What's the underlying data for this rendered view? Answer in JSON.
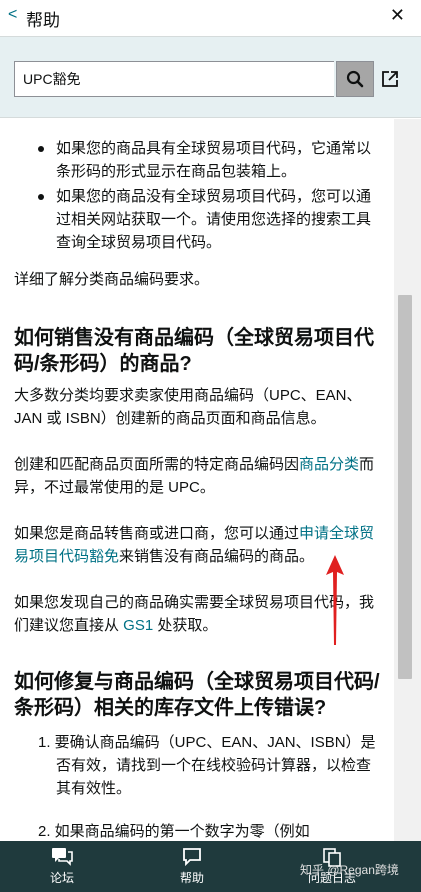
{
  "header": {
    "back_label": "<",
    "title": "帮助",
    "close_label": "✕"
  },
  "search": {
    "value": "UPC豁免",
    "placeholder": ""
  },
  "content": {
    "bullets": [
      "如果您的商品具有全球贸易项目代码，它通常以条形码的形式显示在商品包装箱上。",
      "如果您的商品没有全球贸易项目代码，您可以通过相关网站获取一个。请使用您选择的搜索工具查询全球贸易项目代码。"
    ],
    "learn_more_link": "详细了解分类商品编码要求。",
    "section1": {
      "heading": "如何销售没有商品编码（全球贸易项目代码/条形码）的商品?",
      "p1": "大多数分类均要求卖家使用商品编码（UPC、EAN、JAN 或 ISBN）创建新的商品页面和商品信息。",
      "p2_before": "创建和匹配商品页面所需的特定商品编码因",
      "p2_link": "商品分类",
      "p2_after": "而异，不过最常使用的是 UPC。",
      "p3_before": "如果您是商品转售商或进口商，您可以通过",
      "p3_link": "申请全球贸易项目代码豁免",
      "p3_after": "来销售没有商品编码的商品。",
      "p4_before": "如果您发现自己的商品确实需要全球贸易项目代码，我们建议您直接从 ",
      "p4_link": "GS1",
      "p4_after": " 处获取。"
    },
    "section2": {
      "heading": "如何修复与商品编码（全球贸易项目代码/条形码）相关的库存文件上传错误?",
      "steps": [
        "1. 要确认商品编码（UPC、EAN、JAN、ISBN）是否有效，请找到一个在线校验码计算器，以检查其有效性。",
        "2. 如果商品编码的第一个数字为零（例如"
      ]
    }
  },
  "footer": {
    "forum_label": "论坛",
    "help_label": "帮助",
    "log_label": "问题日志",
    "watermark": "知乎 @Regan跨境"
  },
  "colors": {
    "link": "#007185",
    "footer_bg": "#1f3a3d",
    "search_bar_bg": "#e6f0f2",
    "arrow": "#e02020"
  }
}
